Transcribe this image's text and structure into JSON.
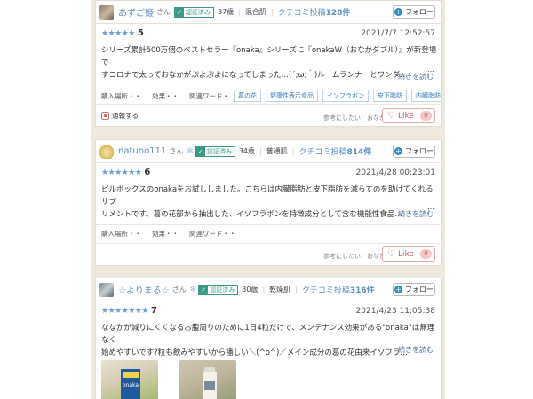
{
  "reviews": [
    {
      "user_name": "あずご姫",
      "honorific": "さん",
      "verified": "認証済み",
      "age": "37歳",
      "skin": "混合肌",
      "posts_label": "クチコミ投稿",
      "posts_count": "128件",
      "follow": "フォロー",
      "rating": "5",
      "date": "2021/7/7 12:52:57",
      "text_lines": [
        "シリーズ累計500万個のベストセラー『onaka』シリーズに『onakaW（おなかダブル）』が新登場で",
        "すコロナで太っておなかがぷよぷよになってしまった…(´;ω;｀)ルームランナーとワンダ…"
      ],
      "read_more": "続きを読む",
      "purchase": "購入場所・・",
      "effect": "効果・・",
      "related": "関連ワード・",
      "tags": [
        "葛の花",
        "健康性表示食品",
        "イソフラボン",
        "皮下脂肪",
        "内臓脂肪"
      ],
      "report": "通報する",
      "helpful": "参考にしたい！おなかどう",
      "like": "Like",
      "like_count": "0"
    },
    {
      "user_name": "natuno111",
      "honorific": "さん",
      "verified": "認証済み",
      "age": "34歳",
      "skin": "普通肌",
      "posts_label": "クチコミ投稿",
      "posts_count": "814件",
      "follow": "フォロー",
      "rating": "6",
      "date": "2021/4/28 00:23:01",
      "text_lines": [
        "ピルボックスのonakaをお試ししました。こちらは内臓脂肪と皮下脂肪を減らすのを助けてくれるサプ",
        "リメントです。葛の花部から抽出した、イソフラボンを特徴成分として含む機能性食品…"
      ],
      "read_more": "続きを読む",
      "purchase": "購入場所・・",
      "effect": "効果・・",
      "related": "関連ワード・・",
      "tags": [],
      "helpful": "参考にしたい！おなかどう",
      "like": "Like",
      "like_count": "0"
    },
    {
      "user_name": "☆よりまる☆",
      "honorific": "さん",
      "verified": "認証済み",
      "age": "30歳",
      "skin": "乾燥肌",
      "posts_label": "クチコミ投稿",
      "posts_count": "316件",
      "follow": "フォロー",
      "rating": "7",
      "date": "2021/4/23 11:05:38",
      "text_lines": [
        "ななかが減りにくくなるお腹周りのために1日4粒だけで、メンテナンス効果がある\"onaka\"は無理なく",
        "始めやすいです?粒も飲みやすいから播しい＼(^o^)／メイン成分の葛の花由来イソフラ…"
      ],
      "read_more": "続きを読む"
    }
  ],
  "colors": {
    "accent_link": "#5a8fc4",
    "verified": "#3a9a86",
    "like": "#c95a5a",
    "star": "#6aa0d6"
  }
}
